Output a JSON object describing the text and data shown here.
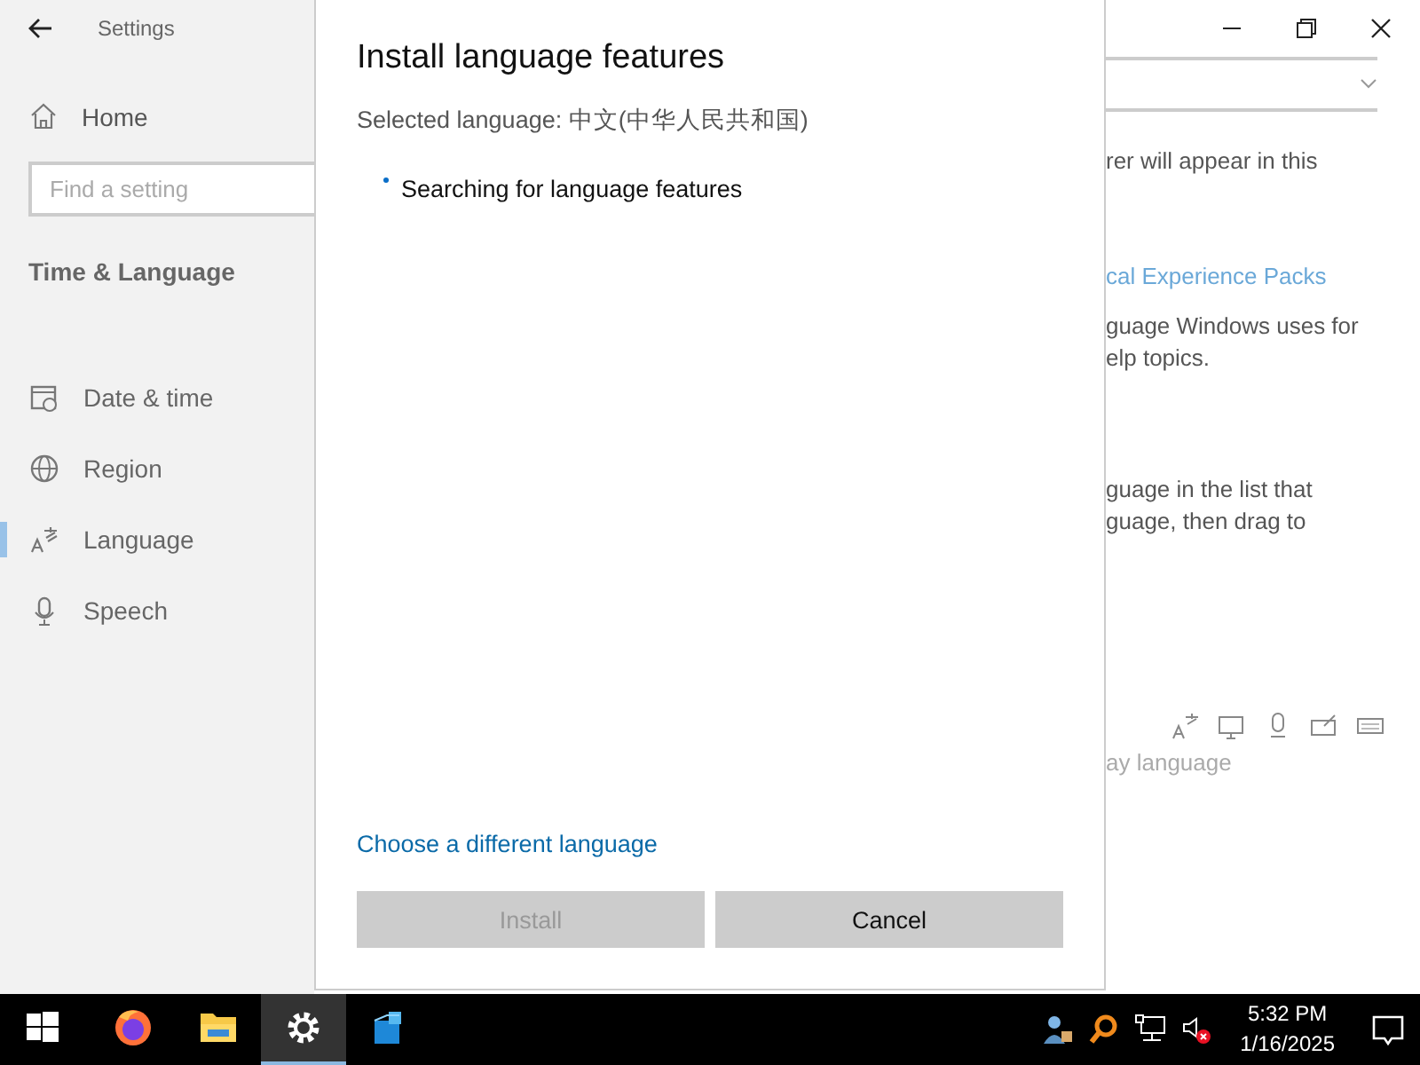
{
  "window": {
    "title": "Settings"
  },
  "sidebar": {
    "home": "Home",
    "search": {
      "placeholder": "Find a setting"
    },
    "section": "Time & Language",
    "items": [
      {
        "label": "Date & time",
        "kind": "calendar",
        "selected": false
      },
      {
        "label": "Region",
        "kind": "globe",
        "selected": false
      },
      {
        "label": "Language",
        "kind": "language",
        "selected": true
      },
      {
        "label": "Speech",
        "kind": "microphone",
        "selected": false
      }
    ]
  },
  "dialog": {
    "title": "Install language features",
    "selected_language": "Selected language: 中文(中华人民共和国)",
    "status": "Searching for language features",
    "link": "Choose a different language",
    "buttons": [
      {
        "label": "Install",
        "disabled": true
      },
      {
        "label": "Cancel",
        "disabled": false
      }
    ]
  },
  "background_page": {
    "blocks": [
      {
        "kind": "dropdown"
      },
      {
        "kind": "text",
        "lines": [
          "rer will appear in this"
        ]
      },
      {
        "kind": "link",
        "lines": [
          "cal Experience Packs"
        ]
      },
      {
        "kind": "text",
        "lines": [
          "guage Windows uses for",
          "elp topics."
        ]
      },
      {
        "kind": "text",
        "lines": [
          "guage in the list that",
          "guage, then drag to"
        ]
      },
      {
        "kind": "icons"
      },
      {
        "kind": "muted",
        "lines": [
          "ay language"
        ]
      }
    ]
  },
  "taskbar": {
    "apps": [
      {
        "kind": "firefox",
        "selected": false
      },
      {
        "kind": "folder",
        "selected": false
      },
      {
        "kind": "settings",
        "selected": true
      },
      {
        "kind": "cube",
        "selected": false
      }
    ],
    "time": "5:32 PM",
    "date": "1/16/2025"
  }
}
